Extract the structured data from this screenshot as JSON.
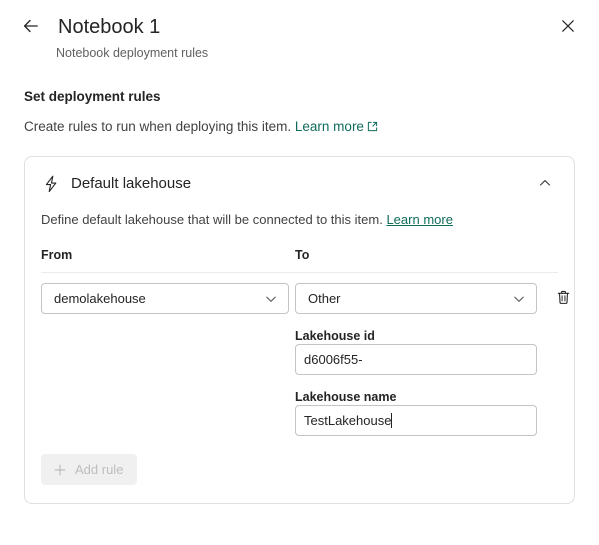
{
  "header": {
    "back_icon": "arrow-left-icon",
    "title": "Notebook 1",
    "subtitle": "Notebook deployment rules",
    "close_icon": "close-icon"
  },
  "section": {
    "title": "Set deployment rules",
    "description": "Create rules to run when deploying this item.",
    "learn_more": "Learn more",
    "external_link_icon": "external-link-icon"
  },
  "card": {
    "icon": "lightning-bolt-icon",
    "title": "Default lakehouse",
    "collapse_icon": "chevron-up-icon",
    "description": "Define default lakehouse that will be connected to this item.",
    "learn_more": "Learn more",
    "columns": {
      "from_label": "From",
      "to_label": "To"
    },
    "from_select": {
      "value": "demolakehouse",
      "chevron_icon": "chevron-down-icon"
    },
    "to_select": {
      "value": "Other",
      "chevron_icon": "chevron-down-icon"
    },
    "delete_icon": "trash-icon",
    "fields": [
      {
        "label": "Lakehouse id",
        "value": "d6006f55-"
      },
      {
        "label": "Lakehouse name",
        "value": "TestLakehouse"
      }
    ],
    "lakehouse_id_label": "Lakehouse id",
    "lakehouse_id_value": "d6006f55-",
    "lakehouse_name_label": "Lakehouse name",
    "lakehouse_name_value": "TestLakehouse",
    "add_rule_label": "Add rule",
    "add_rule_icon": "plus-icon"
  },
  "colors": {
    "link": "#0f6c5b",
    "text": "#242424",
    "muted_text": "#616161",
    "border": "#e0e0e0",
    "input_border": "#c4c4c4",
    "disabled_bg": "#f0f0f0",
    "disabled_text": "#bdbdbd"
  }
}
